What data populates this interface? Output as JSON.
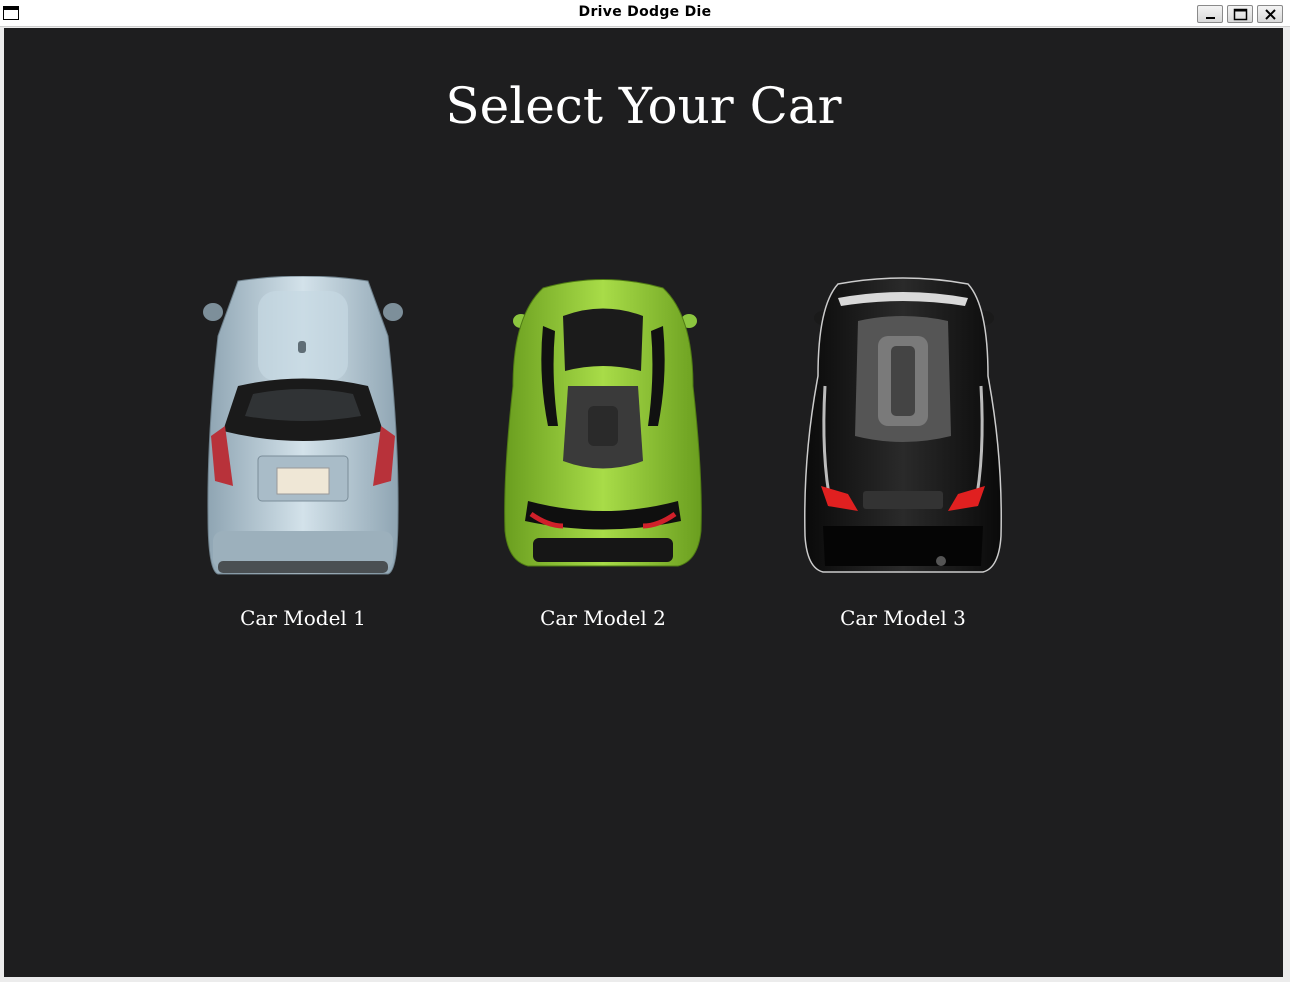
{
  "window": {
    "title": "Drive Dodge Die"
  },
  "screen": {
    "heading": "Select Your Car",
    "background_color": "#1e1e1f",
    "cars": [
      {
        "label": "Car Model 1",
        "color": "#b8ccd8",
        "icon": "silver-hatchback-icon"
      },
      {
        "label": "Car Model 2",
        "color": "#8cc63f",
        "icon": "green-sports-car-icon"
      },
      {
        "label": "Car Model 3",
        "color": "#111111",
        "icon": "black-sports-car-icon"
      }
    ]
  }
}
